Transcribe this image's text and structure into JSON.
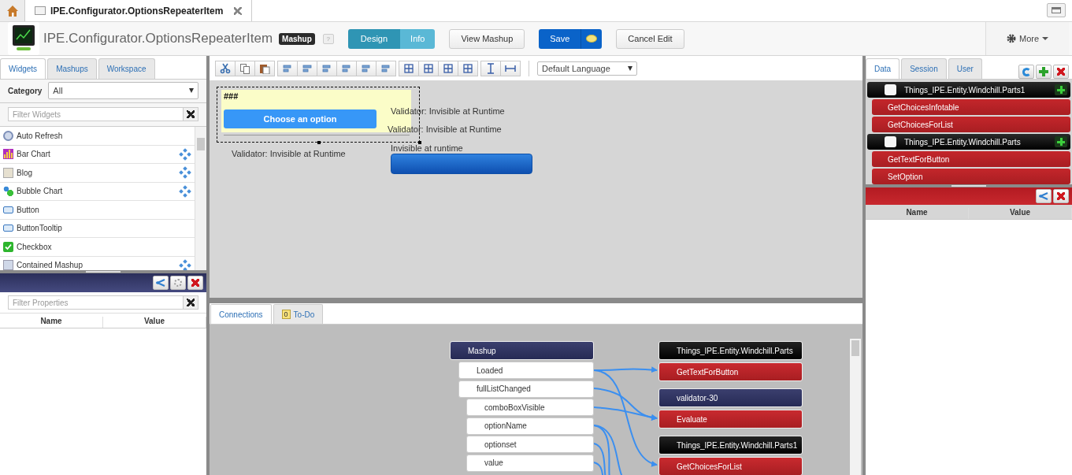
{
  "top_bar": {
    "tab": {
      "title": "IPE.Configurator.OptionsRepeaterItem"
    }
  },
  "header": {
    "title": "IPE.Configurator.OptionsRepeaterItem",
    "badge": "Mashup",
    "help": "?",
    "modes": [
      {
        "label": "Design",
        "selected": true
      },
      {
        "label": "Info",
        "selected": false
      }
    ],
    "view_button": "View Mashup",
    "save_button": "Save",
    "cancel_button": "Cancel Edit",
    "more_menu": "More"
  },
  "left_panel": {
    "tabs": [
      {
        "label": "Widgets",
        "selected": true
      },
      {
        "label": "Mashups",
        "selected": false
      },
      {
        "label": "Workspace",
        "selected": false
      }
    ],
    "category": {
      "label": "Category",
      "value": "All"
    },
    "filter": {
      "placeholder": "Filter Widgets"
    },
    "widgets": [
      {
        "label": "Auto Refresh",
        "kind": "clock",
        "draggable": false
      },
      {
        "label": "Bar Chart",
        "kind": "bars",
        "draggable": true
      },
      {
        "label": "Blog",
        "kind": "blog",
        "draggable": true
      },
      {
        "label": "Bubble Chart",
        "kind": "bubble",
        "draggable": true
      },
      {
        "label": "Button",
        "kind": "button",
        "draggable": false
      },
      {
        "label": "ButtonTooltip",
        "kind": "button",
        "draggable": false
      },
      {
        "label": "Checkbox",
        "kind": "checkbox",
        "draggable": false
      },
      {
        "label": "Contained Mashup",
        "kind": "mashup",
        "draggable": true
      }
    ],
    "properties": {
      "filter": {
        "placeholder": "Filter Properties"
      },
      "columns": [
        "Name",
        "Value"
      ]
    }
  },
  "canvas": {
    "toolbar": {
      "language": "Default Language"
    },
    "repeater": {
      "heading": "###",
      "button": "Choose an option"
    },
    "labels": [
      "Validator: Invisible at Runtime",
      "Validator: Invisible at Runtime",
      "Invisible at runtime",
      "Validator: Invisible at Runtime"
    ]
  },
  "connections": {
    "tabs": [
      {
        "label": "Connections",
        "selected": true
      },
      {
        "label": "To-Do",
        "selected": false,
        "count": "0"
      }
    ],
    "source": {
      "title": "Mashup",
      "events": [
        "Loaded",
        "fullListChanged"
      ],
      "properties": [
        "comboBoxVisible",
        "optionName",
        "optionset",
        "value"
      ]
    },
    "targets": [
      {
        "title": "Things_IPE.Entity.Windchill.Parts",
        "kind": "thing",
        "services": [
          "GetTextForButton"
        ]
      },
      {
        "title": "validator-30",
        "kind": "widget",
        "services": [
          "Evaluate"
        ]
      },
      {
        "title": "Things_IPE.Entity.Windchill.Parts1",
        "kind": "thing",
        "services": [
          "GetChoicesForList"
        ]
      }
    ]
  },
  "right_panel": {
    "tabs": [
      {
        "label": "Data",
        "selected": true
      },
      {
        "label": "Session",
        "selected": false
      },
      {
        "label": "User",
        "selected": false
      }
    ],
    "things": [
      {
        "name": "Things_IPE.Entity.Windchill.Parts1",
        "checked": false,
        "services": [
          "GetChoicesInfotable",
          "GetChoicesForList"
        ]
      },
      {
        "name": "Things_IPE.Entity.Windchill.Parts",
        "checked": false,
        "services": [
          "GetTextForButton",
          "SetOption"
        ]
      }
    ],
    "properties": {
      "columns": [
        "Name",
        "Value"
      ]
    }
  }
}
